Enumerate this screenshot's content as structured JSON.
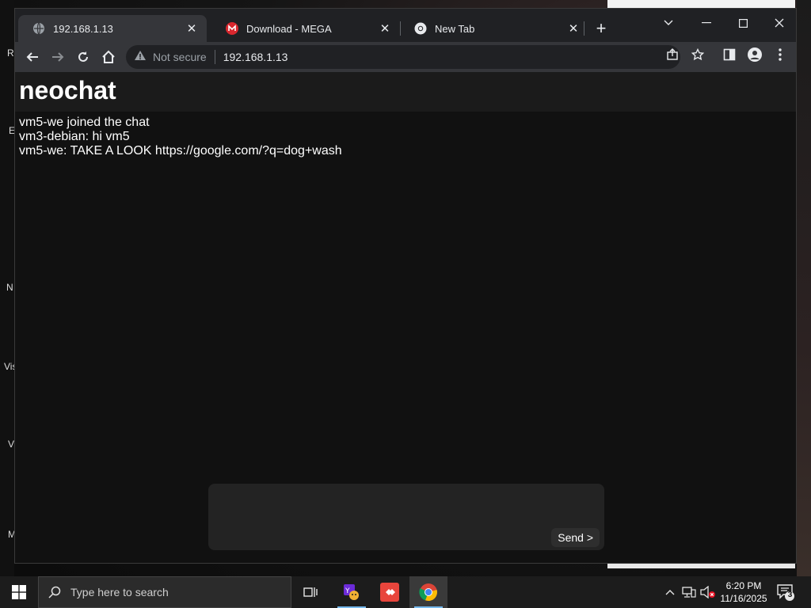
{
  "browser": {
    "tabs": [
      {
        "title": "192.168.1.13",
        "favicon": "globe-icon",
        "active": true
      },
      {
        "title": "Download - MEGA",
        "favicon": "mega-icon",
        "active": false
      },
      {
        "title": "New Tab",
        "favicon": "chrome-icon",
        "active": false
      }
    ],
    "address": {
      "security_label": "Not secure",
      "url": "192.168.1.13"
    }
  },
  "page": {
    "app_title": "neochat",
    "messages": [
      "vm5-we joined the chat",
      "vm3-debian: hi vm5",
      "vm5-we: TAKE A LOOK https://google.com/?q=dog+wash"
    ],
    "composer": {
      "value": "",
      "send_label": "Send >"
    }
  },
  "taskbar": {
    "search_placeholder": "Type here to search",
    "clock_time": "6:20 PM",
    "clock_date": "11/16/2025",
    "notification_count": "3"
  },
  "desktop": {
    "side_labels": [
      "R",
      "E",
      "N",
      "Vis",
      "V",
      "M"
    ]
  },
  "colors": {
    "chrome_dark": "#202124",
    "toolbar": "#35363a",
    "page_bg": "#111111",
    "header_bg": "#1b1b1b",
    "accent": "#76b9ed"
  }
}
